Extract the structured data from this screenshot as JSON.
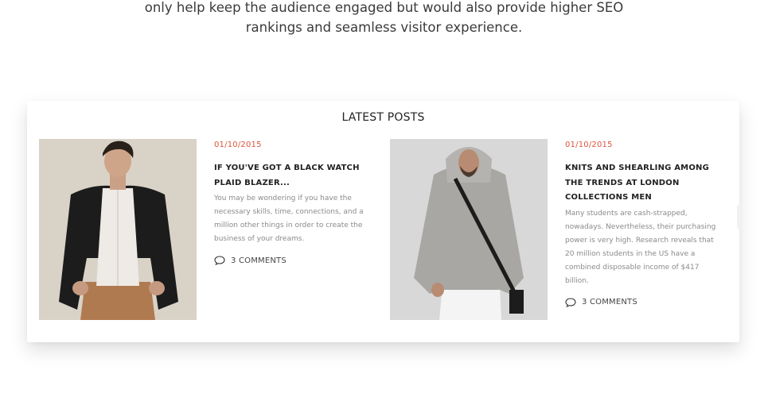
{
  "intro": {
    "lines": [
      "only help keep the audience engaged but would also provide higher SEO",
      "rankings and seamless visitor experience."
    ]
  },
  "latest_posts": {
    "title": "LATEST POSTS",
    "posts": [
      {
        "date": "01/10/2015",
        "title": "IF YOU'VE GOT A BLACK WATCH PLAID BLAZER...",
        "excerpt": "You may be wondering if you have the necessary skills, time, connections, and a million other things in order to create the business of your dreams.",
        "comments": "3 COMMENTS",
        "image_icon": "man-in-black-blazer-photo"
      },
      {
        "date": "01/10/2015",
        "title": "KNITS AND SHEARLING AMONG THE TRENDS AT LONDON COLLECTIONS MEN",
        "excerpt": "Many students are cash-strapped, nowadays. Nevertheless, their purchasing power is very high. Research reveals that 20 million students in the US have a combined disposable income of $417 billion.",
        "comments": "3 COMMENTS",
        "image_icon": "man-in-grey-hoodie-photo"
      }
    ]
  },
  "colors": {
    "accent_date": "#e0533c",
    "title_text": "#222222",
    "excerpt_text": "#8a8a8a"
  }
}
